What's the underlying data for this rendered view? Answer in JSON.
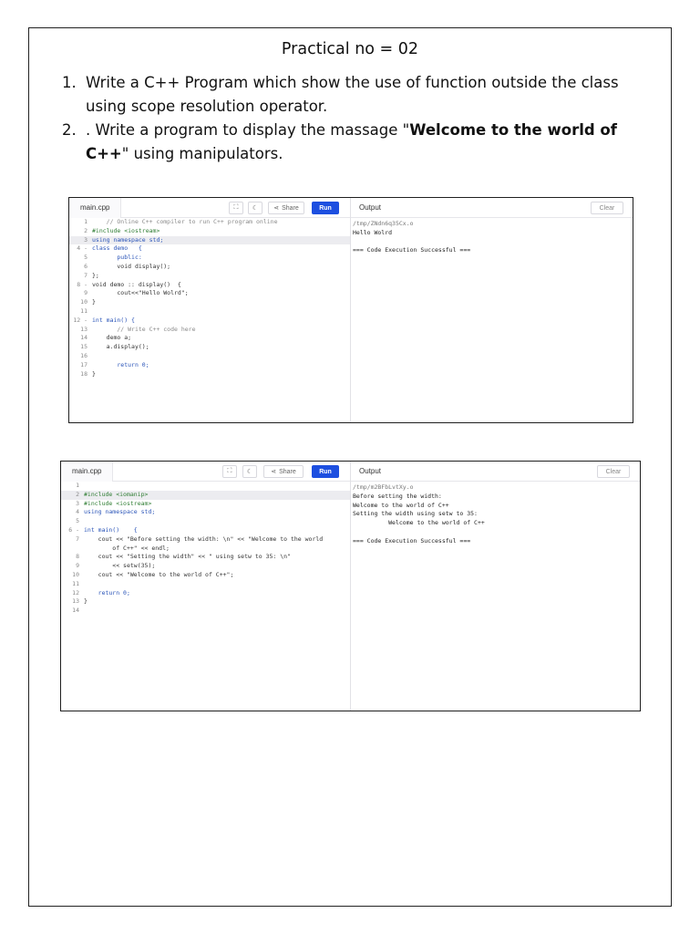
{
  "document": {
    "title": "Practical no = 02",
    "questions": [
      {
        "num": "1.",
        "text": "Write a C++ Program which show the use of function outside the class using scope resolution operator."
      },
      {
        "num": "2.",
        "text_before": ". Write a program to display the massage \"",
        "text_bold": "Welcome to the world of C++",
        "text_after": "\" using manipulators."
      }
    ]
  },
  "toolbar": {
    "share_label": "Share",
    "run_label": "Run",
    "output_label": "Output",
    "clear_label": "Clear"
  },
  "editor1": {
    "filename": "main.cpp",
    "code": [
      {
        "n": "1",
        "t": "    // Online C++ compiler to run C++ program online",
        "cls": "c-com"
      },
      {
        "n": "2",
        "t": "#include <iostream>",
        "cls": "c-inc"
      },
      {
        "n": "3",
        "t": "using namespace std;",
        "cls": "c-kw",
        "hl": true
      },
      {
        "n": "4 -",
        "t": "class demo   {",
        "cls": "c-kw"
      },
      {
        "n": "5",
        "t": "       public:",
        "cls": "c-kw"
      },
      {
        "n": "6",
        "t": "       void display();",
        "cls": ""
      },
      {
        "n": "7",
        "t": "};",
        "cls": ""
      },
      {
        "n": "8 -",
        "t": "void demo :: display()  {",
        "cls": ""
      },
      {
        "n": "9",
        "t": "       cout<<\"Hello Wolrd\";",
        "cls": ""
      },
      {
        "n": "10",
        "t": "}",
        "cls": ""
      },
      {
        "n": "11",
        "t": "",
        "cls": ""
      },
      {
        "n": "12 -",
        "t": "int main() {",
        "cls": "c-kw"
      },
      {
        "n": "13",
        "t": "       // Write C++ code here",
        "cls": "c-com"
      },
      {
        "n": "14",
        "t": "    demo a;",
        "cls": ""
      },
      {
        "n": "15",
        "t": "    a.display();",
        "cls": ""
      },
      {
        "n": "16",
        "t": "",
        "cls": ""
      },
      {
        "n": "17",
        "t": "       return 0;",
        "cls": "c-kw"
      },
      {
        "n": "18",
        "t": "}",
        "cls": ""
      }
    ],
    "output": [
      {
        "t": "/tmp/ZNdn6q35Cx.o",
        "dim": true
      },
      {
        "t": "Hello Wolrd",
        "dim": false
      },
      {
        "t": "",
        "dim": false
      },
      {
        "t": "=== Code Execution Successful ===",
        "dim": false
      }
    ]
  },
  "editor2": {
    "filename": "main.cpp",
    "code": [
      {
        "n": "1",
        "t": "",
        "cls": ""
      },
      {
        "n": "2",
        "t": "#include <iomanip>",
        "cls": "c-inc",
        "hl": true
      },
      {
        "n": "3",
        "t": "#include <iostream>",
        "cls": "c-inc"
      },
      {
        "n": "4",
        "t": "using namespace std;",
        "cls": "c-kw"
      },
      {
        "n": "5",
        "t": "",
        "cls": ""
      },
      {
        "n": "6 -",
        "t": "int main()    {",
        "cls": "c-kw"
      },
      {
        "n": "7",
        "t": "    cout << \"Before setting the width: \\n\" << \"Welcome to the world",
        "cls": ""
      },
      {
        "n": "",
        "t": "        of C++\" << endl;",
        "cls": ""
      },
      {
        "n": "8",
        "t": "    cout << \"Setting the width\" << \" using setw to 35: \\n\"",
        "cls": ""
      },
      {
        "n": "9",
        "t": "        << setw(35);",
        "cls": ""
      },
      {
        "n": "10",
        "t": "    cout << \"Welcome to the world of C++\";",
        "cls": ""
      },
      {
        "n": "11",
        "t": "",
        "cls": ""
      },
      {
        "n": "12",
        "t": "    return 0;",
        "cls": "c-kw"
      },
      {
        "n": "13",
        "t": "}",
        "cls": ""
      },
      {
        "n": "14",
        "t": "",
        "cls": ""
      }
    ],
    "output": [
      {
        "t": "/tmp/m2BFbLvtXy.o",
        "dim": true
      },
      {
        "t": "Before setting the width:",
        "dim": false
      },
      {
        "t": "Welcome to the world of C++",
        "dim": false
      },
      {
        "t": "Setting the width using setw to 35:",
        "dim": false
      },
      {
        "t": "          Welcome to the world of C++",
        "dim": false
      },
      {
        "t": "",
        "dim": false
      },
      {
        "t": "=== Code Execution Successful ===",
        "dim": false
      }
    ]
  },
  "colors": {
    "run_button": "#1d4fe0",
    "keyword": "#2a54b8",
    "include": "#2e7d32",
    "comment": "#8a8a8a"
  }
}
